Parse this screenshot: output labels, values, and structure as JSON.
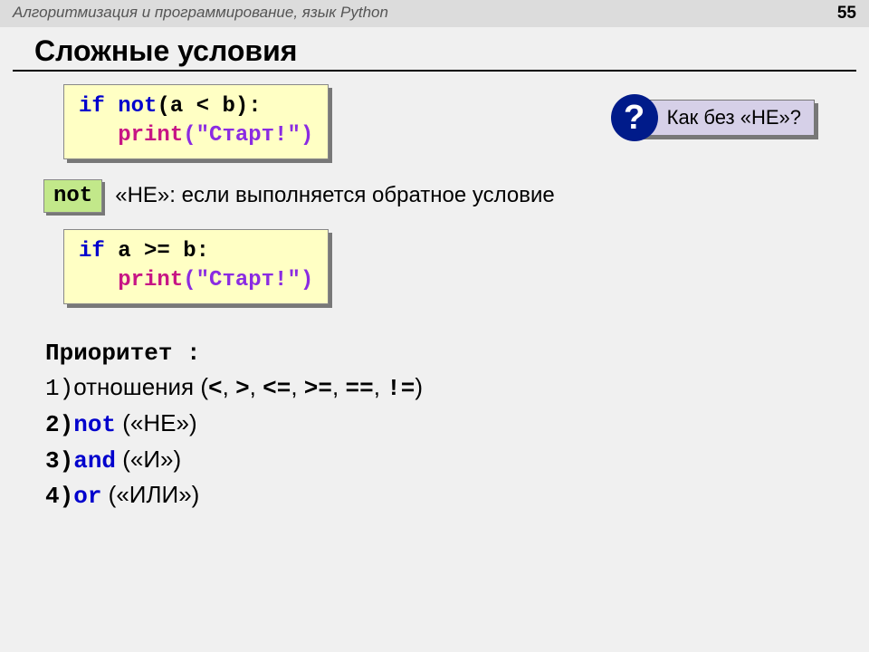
{
  "header": {
    "subject": "Алгоритмизация и программирование, язык Python",
    "page": "55"
  },
  "title": "Сложные условия",
  "code1": {
    "if": "if",
    "not": "not",
    "cond": "(a < b):",
    "indent": "   ",
    "print": "print",
    "args": "(\"Старт!\")"
  },
  "callout": {
    "mark": "?",
    "text": "Как без «НЕ»?"
  },
  "notRow": {
    "badge": "not",
    "desc": "«НЕ»: если выполняется обратное условие"
  },
  "code2": {
    "if": "if",
    "cond": " a >= b:",
    "indent": "   ",
    "print": "print",
    "args": "(\"Старт!\")"
  },
  "priority": {
    "title": "Приоритет :",
    "l1a": "1)",
    "l1b": "отношения (",
    "l1c": "<",
    "l1d": ", ",
    "l1e": ">",
    "l1f": ", ",
    "l1g": "<=",
    "l1h": ", ",
    "l1i": ">=",
    "l1j": ", ",
    "l1k": "==",
    "l1l": ", ",
    "l1m": "!=",
    "l1n": ")",
    "l2a": "2)",
    "l2b": "not",
    "l2c": " («НЕ»)",
    "l3a": "3)",
    "l3b": "and",
    "l3c": " («И»)",
    "l4a": "4)",
    "l4b": "or",
    "l4c": " («ИЛИ»)"
  }
}
